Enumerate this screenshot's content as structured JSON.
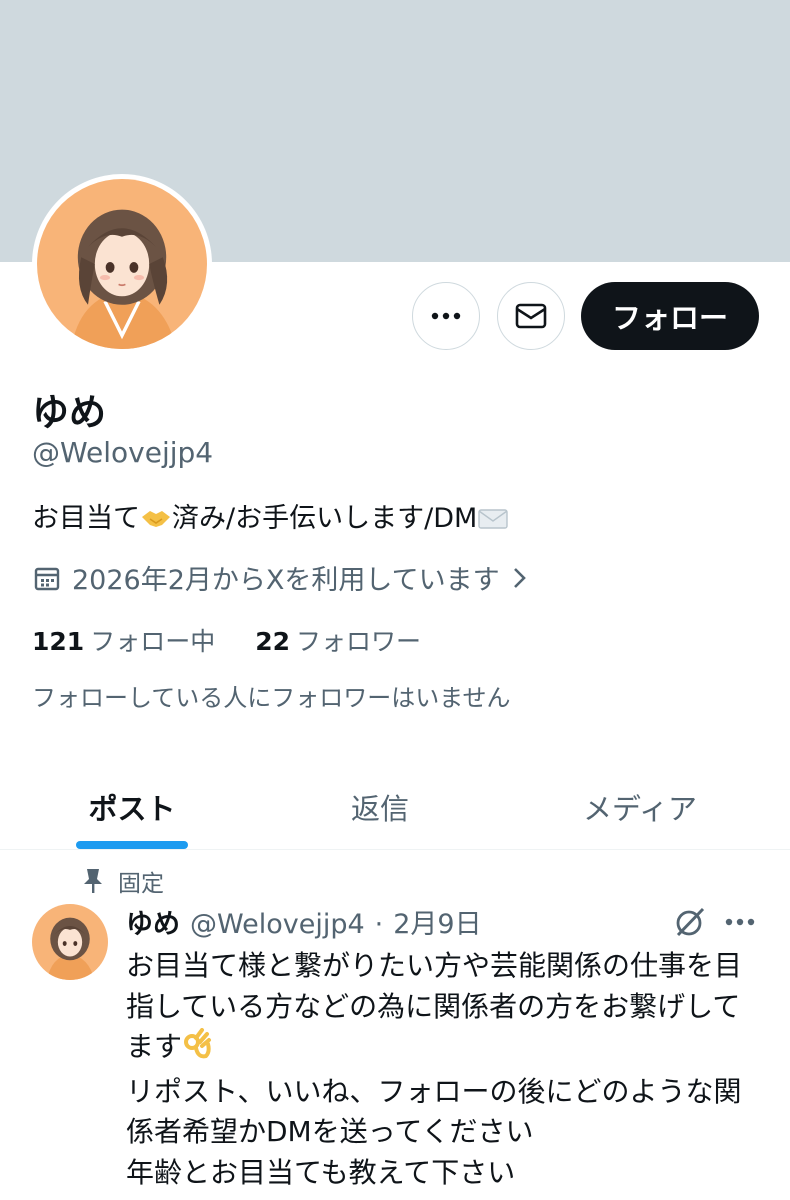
{
  "profile": {
    "name": "ゆめ",
    "handle": "@Welovejjp4",
    "bio_part1": "お目当て",
    "bio_part2": "済み/お手伝いします/DM",
    "joined": "2026年2月からXを利用しています",
    "following_count": "121",
    "following_label": "フォロー中",
    "followers_count": "22",
    "followers_label": "フォロワー",
    "no_followers_known": "フォローしている人にフォロワーはいません"
  },
  "actions": {
    "follow_label": "フォロー"
  },
  "tabs": [
    {
      "label": "ポスト",
      "active": true
    },
    {
      "label": "返信",
      "active": false
    },
    {
      "label": "メディア",
      "active": false
    }
  ],
  "post": {
    "pinned_label": "固定",
    "author_name": "ゆめ",
    "author_handle": "@Welovejjp4",
    "separator": "·",
    "date": "2月9日",
    "lines": [
      "お目当て様と繋がりたい方や芸能関係の仕事を目",
      "指している方などの為に関係者の方をお繋げして",
      "ます",
      "リポスト、いいね、フォローの後にどのような関",
      "係者希望かDMを送ってください",
      "年齢とお目当ても教えて下さい"
    ]
  },
  "icons": {
    "more": "more-horizontal-icon",
    "message": "envelope-icon",
    "calendar": "calendar-icon",
    "chevron": "chevron-right-icon",
    "pin": "pin-icon",
    "grok": "grok-icon",
    "handshake": "handshake-emoji",
    "mail_emoji": "envelope-emoji",
    "ok_hand": "ok-hand-emoji"
  },
  "colors": {
    "banner": "#cfd9de",
    "accent": "#1d9bf0",
    "text": "#0f1419",
    "secondary": "#536471",
    "follow_button": "#0f1419"
  }
}
